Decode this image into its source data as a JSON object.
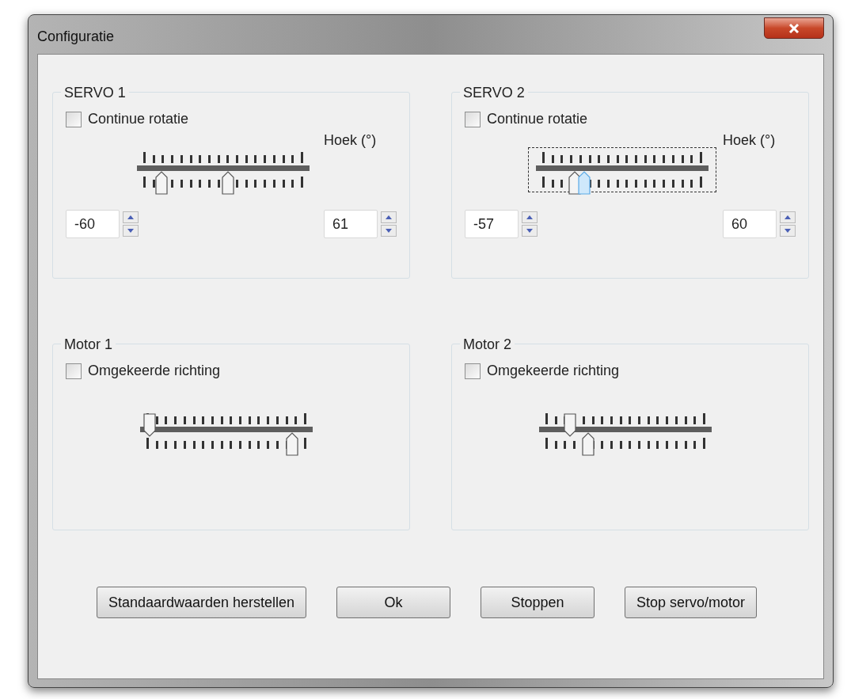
{
  "window": {
    "title": "Configuratie"
  },
  "groups": [
    {
      "kind": "servo",
      "title": "SERVO 1",
      "checkbox": {
        "label": "Continue rotatie",
        "checked": false
      },
      "slider": {
        "focused": false,
        "thumbs": [
          {
            "kind": "bottom",
            "level": 0.1,
            "selected": false
          },
          {
            "kind": "bottom",
            "level": 0.53,
            "selected": false
          }
        ]
      },
      "angle_label": "Hoek (°)",
      "min": "-60",
      "max": "61"
    },
    {
      "kind": "servo",
      "title": "SERVO 2",
      "checkbox": {
        "label": "Continue rotatie",
        "checked": false
      },
      "slider": {
        "focused": true,
        "thumbs": [
          {
            "kind": "bottom",
            "level": 0.19,
            "selected": false
          },
          {
            "kind": "bottom",
            "level": 0.25,
            "selected": true
          }
        ]
      },
      "angle_label": "Hoek (°)",
      "min": "-57",
      "max": "60"
    },
    {
      "kind": "motor",
      "title": "Motor 1",
      "checkbox": {
        "label": "Omgekeerde richting",
        "checked": false
      },
      "slider": {
        "focused": false,
        "thumbs": [
          {
            "kind": "top",
            "level": 0.0,
            "selected": false
          },
          {
            "kind": "bottom",
            "level": 0.93,
            "selected": false
          }
        ]
      }
    },
    {
      "kind": "motor",
      "title": "Motor 2",
      "checkbox": {
        "label": "Omgekeerde richting",
        "checked": false
      },
      "slider": {
        "focused": false,
        "thumbs": [
          {
            "kind": "top",
            "level": 0.14,
            "selected": false
          },
          {
            "kind": "bottom",
            "level": 0.26,
            "selected": false
          }
        ]
      }
    }
  ],
  "buttons": [
    "Standaardwaarden herstellen",
    "Ok",
    "Stoppen",
    "Stop servo/motor"
  ]
}
